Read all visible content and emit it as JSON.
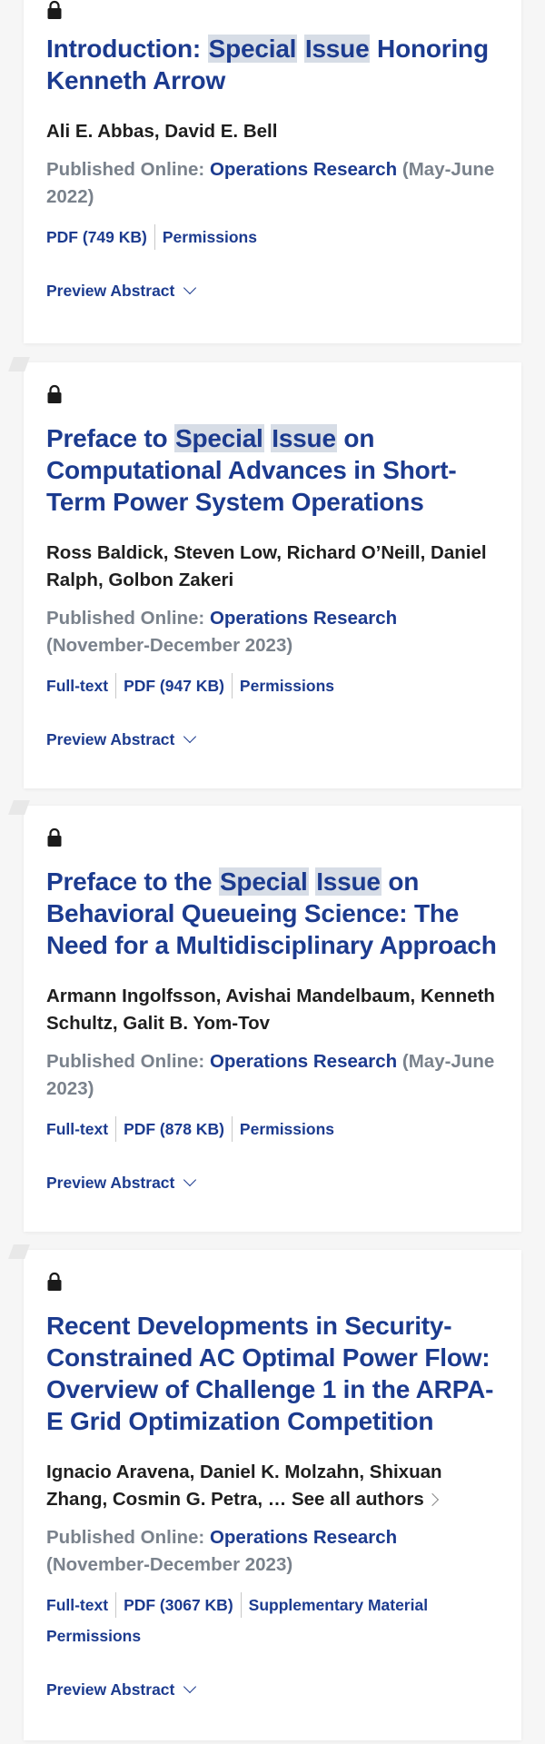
{
  "items": [
    {
      "title_parts": [
        "Introduction: ",
        "Special",
        " ",
        "Issue",
        " Honoring Kenneth Arrow"
      ],
      "authors": "Ali E. Abbas, David E. Bell",
      "published_label": "Published Online: ",
      "journal": "Operations Research",
      "date": " (May-June 2022)",
      "links": [
        "PDF (749 KB)",
        "Permissions"
      ],
      "preview": "Preview Abstract"
    },
    {
      "title_parts": [
        "Preface to ",
        "Special",
        " ",
        "Issue",
        " on Computational Advances in Short-Term Power System Operations"
      ],
      "authors": "Ross Baldick, Steven Low, Richard O’Neill, Daniel Ralph, Golbon Zakeri",
      "published_label": "Published Online: ",
      "journal": "Operations Research",
      "date": " (November-December 2023)",
      "links": [
        "Full-text",
        "PDF (947 KB)",
        "Permissions"
      ],
      "preview": "Preview Abstract"
    },
    {
      "title_parts": [
        "Preface to the ",
        "Special",
        " ",
        "Issue",
        " on Behavioral Queueing Science: The Need for a Multidisciplinary Approach"
      ],
      "authors": "Armann Ingolfsson, Avishai Mandelbaum, Kenneth Schultz, Galit B. Yom-Tov",
      "published_label": "Published Online: ",
      "journal": "Operations Research",
      "date": " (May-June 2023)",
      "links": [
        "Full-text",
        "PDF (878 KB)",
        "Permissions"
      ],
      "preview": "Preview Abstract"
    },
    {
      "title_parts": [
        "Recent Developments in Security-Constrained AC Optimal Power Flow: Overview of Challenge 1 in the ARPA-E Grid Optimization Competition"
      ],
      "authors": "Ignacio Aravena, Daniel K. Molzahn, Shixuan Zhang, Cosmin G. Petra, … ",
      "see_all": "See all authors",
      "published_label": "Published Online: ",
      "journal": "Operations Research",
      "date": " (November-December 2023)",
      "links": [
        "Full-text",
        "PDF (3067 KB)",
        "Supplementary Material",
        "Permissions"
      ],
      "preview": "Preview Abstract"
    }
  ]
}
